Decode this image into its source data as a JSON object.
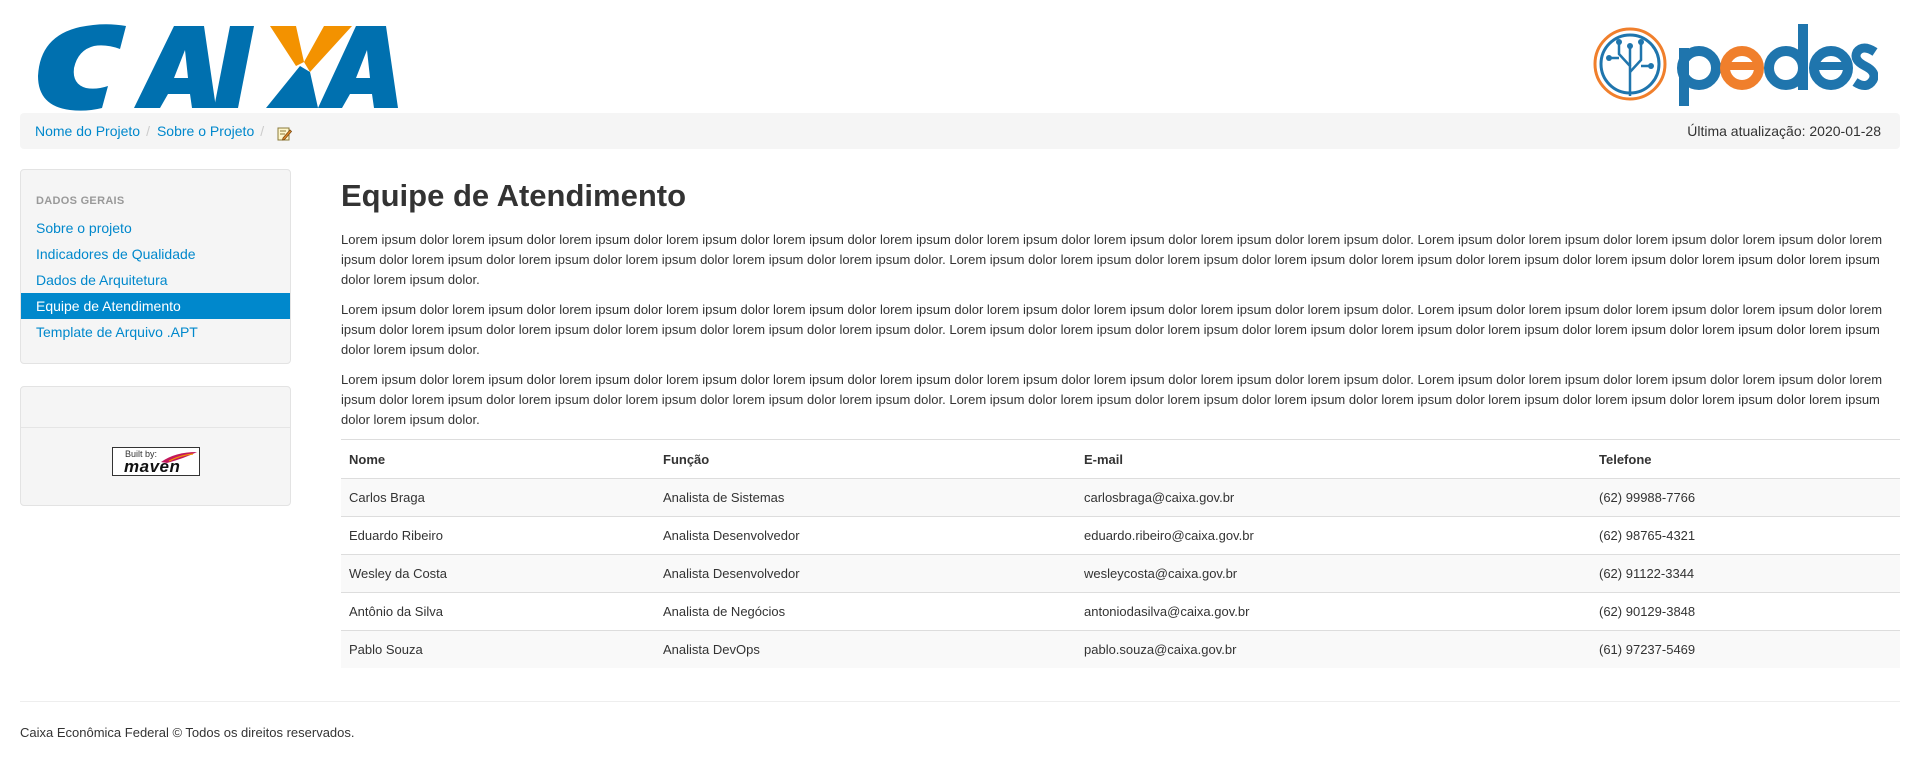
{
  "header": {
    "caixa_logo_text": "CAIXA",
    "pedes_logo_text": "pedes",
    "colors": {
      "caixa_blue": "#0070af",
      "caixa_orange": "#f39200",
      "pedes_blue": "#1f75ad",
      "pedes_orange": "#f07f2c"
    }
  },
  "breadcrumb": {
    "items": [
      "Nome do Projeto",
      "Sobre o Projeto"
    ],
    "divider": "/",
    "edit_icon": "edit-icon",
    "last_updated": "Última atualização: 2020-01-28"
  },
  "sidebar": {
    "header": "DADOS GERAIS",
    "items": [
      {
        "label": "Sobre o projeto",
        "active": false
      },
      {
        "label": "Indicadores de Qualidade",
        "active": false
      },
      {
        "label": "Dados de Arquitetura",
        "active": false
      },
      {
        "label": "Equipe de Atendimento",
        "active": true
      },
      {
        "label": "Template de Arquivo .APT",
        "active": false
      }
    ],
    "badge": {
      "built_by": "Built by:",
      "name": "maven"
    }
  },
  "main": {
    "title": "Equipe de Atendimento",
    "paragraphs": [
      "Lorem ipsum dolor lorem ipsum dolor lorem ipsum dolor lorem ipsum dolor lorem ipsum dolor lorem ipsum dolor lorem ipsum dolor lorem ipsum dolor lorem ipsum dolor lorem ipsum dolor. Lorem ipsum dolor lorem ipsum dolor lorem ipsum dolor lorem ipsum dolor lorem ipsum dolor lorem ipsum dolor lorem ipsum dolor lorem ipsum dolor lorem ipsum dolor lorem ipsum dolor. Lorem ipsum dolor lorem ipsum dolor lorem ipsum dolor lorem ipsum dolor lorem ipsum dolor lorem ipsum dolor lorem ipsum dolor lorem ipsum dolor lorem ipsum dolor lorem ipsum dolor.",
      "Lorem ipsum dolor lorem ipsum dolor lorem ipsum dolor lorem ipsum dolor lorem ipsum dolor lorem ipsum dolor lorem ipsum dolor lorem ipsum dolor lorem ipsum dolor lorem ipsum dolor. Lorem ipsum dolor lorem ipsum dolor lorem ipsum dolor lorem ipsum dolor lorem ipsum dolor lorem ipsum dolor lorem ipsum dolor lorem ipsum dolor lorem ipsum dolor lorem ipsum dolor. Lorem ipsum dolor lorem ipsum dolor lorem ipsum dolor lorem ipsum dolor lorem ipsum dolor lorem ipsum dolor lorem ipsum dolor lorem ipsum dolor lorem ipsum dolor lorem ipsum dolor.",
      "Lorem ipsum dolor lorem ipsum dolor lorem ipsum dolor lorem ipsum dolor lorem ipsum dolor lorem ipsum dolor lorem ipsum dolor lorem ipsum dolor lorem ipsum dolor lorem ipsum dolor. Lorem ipsum dolor lorem ipsum dolor lorem ipsum dolor lorem ipsum dolor lorem ipsum dolor lorem ipsum dolor lorem ipsum dolor lorem ipsum dolor lorem ipsum dolor lorem ipsum dolor. Lorem ipsum dolor lorem ipsum dolor lorem ipsum dolor lorem ipsum dolor lorem ipsum dolor lorem ipsum dolor lorem ipsum dolor lorem ipsum dolor lorem ipsum dolor lorem ipsum dolor."
    ],
    "table": {
      "headers": [
        "Nome",
        "Função",
        "E-mail",
        "Telefone"
      ],
      "rows": [
        [
          "Carlos Braga",
          "Analista de Sistemas",
          "carlosbraga@caixa.gov.br",
          "(62) 99988-7766"
        ],
        [
          "Eduardo Ribeiro",
          "Analista Desenvolvedor",
          "eduardo.ribeiro@caixa.gov.br",
          "(62) 98765-4321"
        ],
        [
          "Wesley da Costa",
          "Analista Desenvolvedor",
          "wesleycosta@caixa.gov.br",
          "(62) 91122-3344"
        ],
        [
          "Antônio da Silva",
          "Analista de Negócios",
          "antoniodasilva@caixa.gov.br",
          "(62) 90129-3848"
        ],
        [
          "Pablo Souza",
          "Analista DevOps",
          "pablo.souza@caixa.gov.br",
          "(61) 97237-5469"
        ]
      ]
    }
  },
  "footer": {
    "text": "Caixa Econômica Federal © Todos os direitos reservados."
  }
}
